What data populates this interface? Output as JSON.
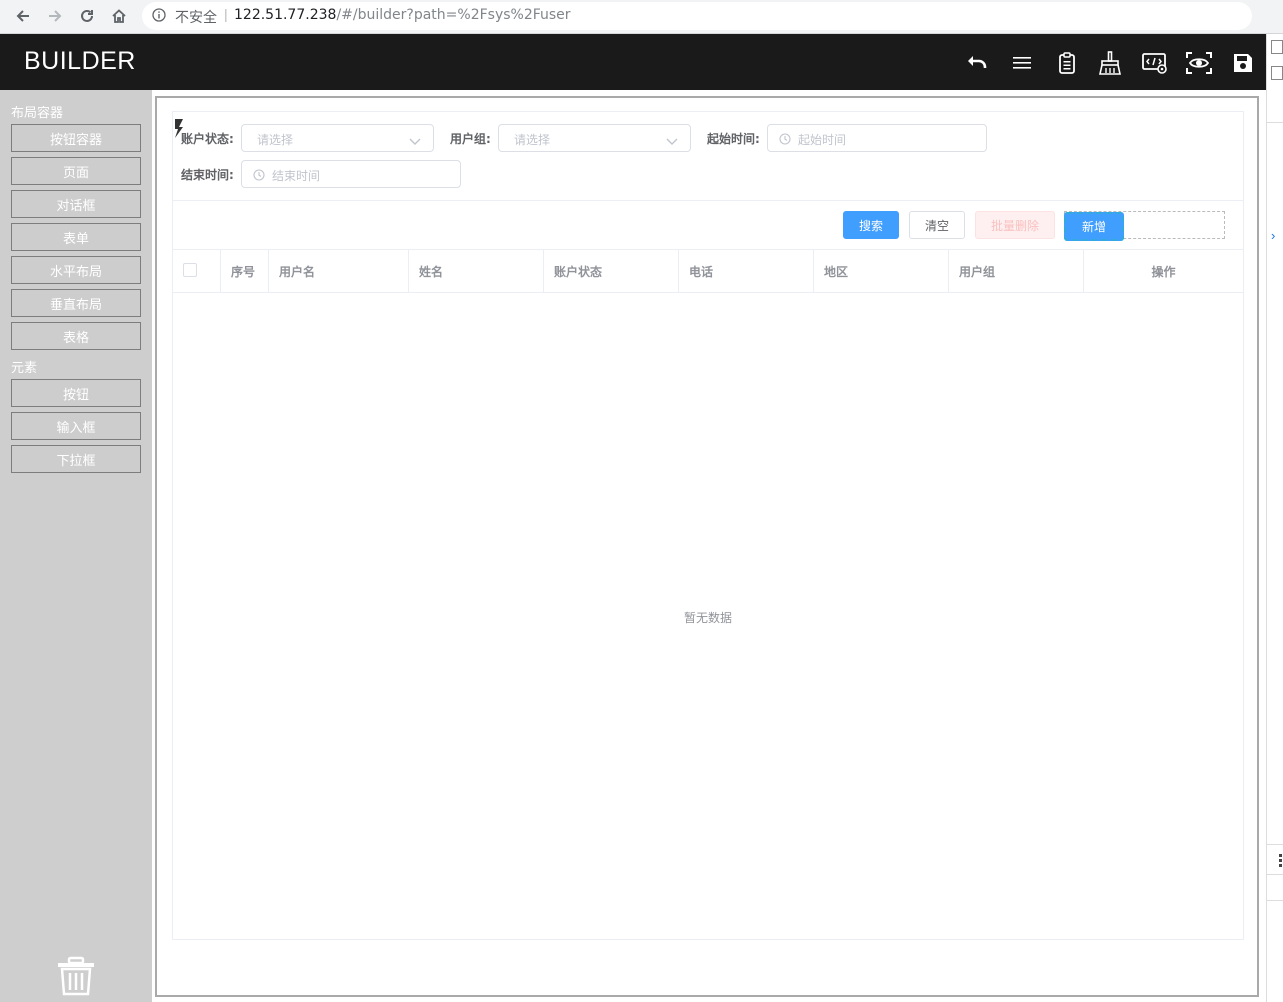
{
  "browser": {
    "security_label": "不安全",
    "url_host": "122.51.77.238",
    "url_path": "/#/builder?path=%2Fsys%2Fuser"
  },
  "app": {
    "title": "BUILDER",
    "toolbar": [
      "undo-icon",
      "list-icon",
      "clipboard-icon",
      "broom-icon",
      "code-icon",
      "preview-eye-icon",
      "save-icon"
    ]
  },
  "sidebar": {
    "layout_section": "布局容器",
    "layout_items": [
      "按钮容器",
      "页面",
      "对话框",
      "表单",
      "水平布局",
      "垂直布局",
      "表格"
    ],
    "element_section": "元素",
    "element_items": [
      "按钮",
      "输入框",
      "下拉框"
    ],
    "trash_icon": "trash-icon"
  },
  "search_form": {
    "account_status_label": "账户状态:",
    "account_status_placeholder": "请选择",
    "user_group_label": "用户组:",
    "user_group_placeholder": "请选择",
    "start_time_label": "起始时间:",
    "start_time_placeholder": "起始时间",
    "end_time_label": "结束时间:",
    "end_time_placeholder": "结束时间"
  },
  "actions": {
    "search": "搜索",
    "clear": "清空",
    "batch_delete": "批量删除",
    "add": "新增"
  },
  "table": {
    "columns": [
      "序号",
      "用户名",
      "姓名",
      "账户状态",
      "电话",
      "地区",
      "用户组",
      "操作"
    ],
    "empty_text": "暂无数据"
  },
  "colors": {
    "primary": "#409eff",
    "header_bg": "#1a1a1a",
    "sidebar_bg": "#cecece"
  }
}
